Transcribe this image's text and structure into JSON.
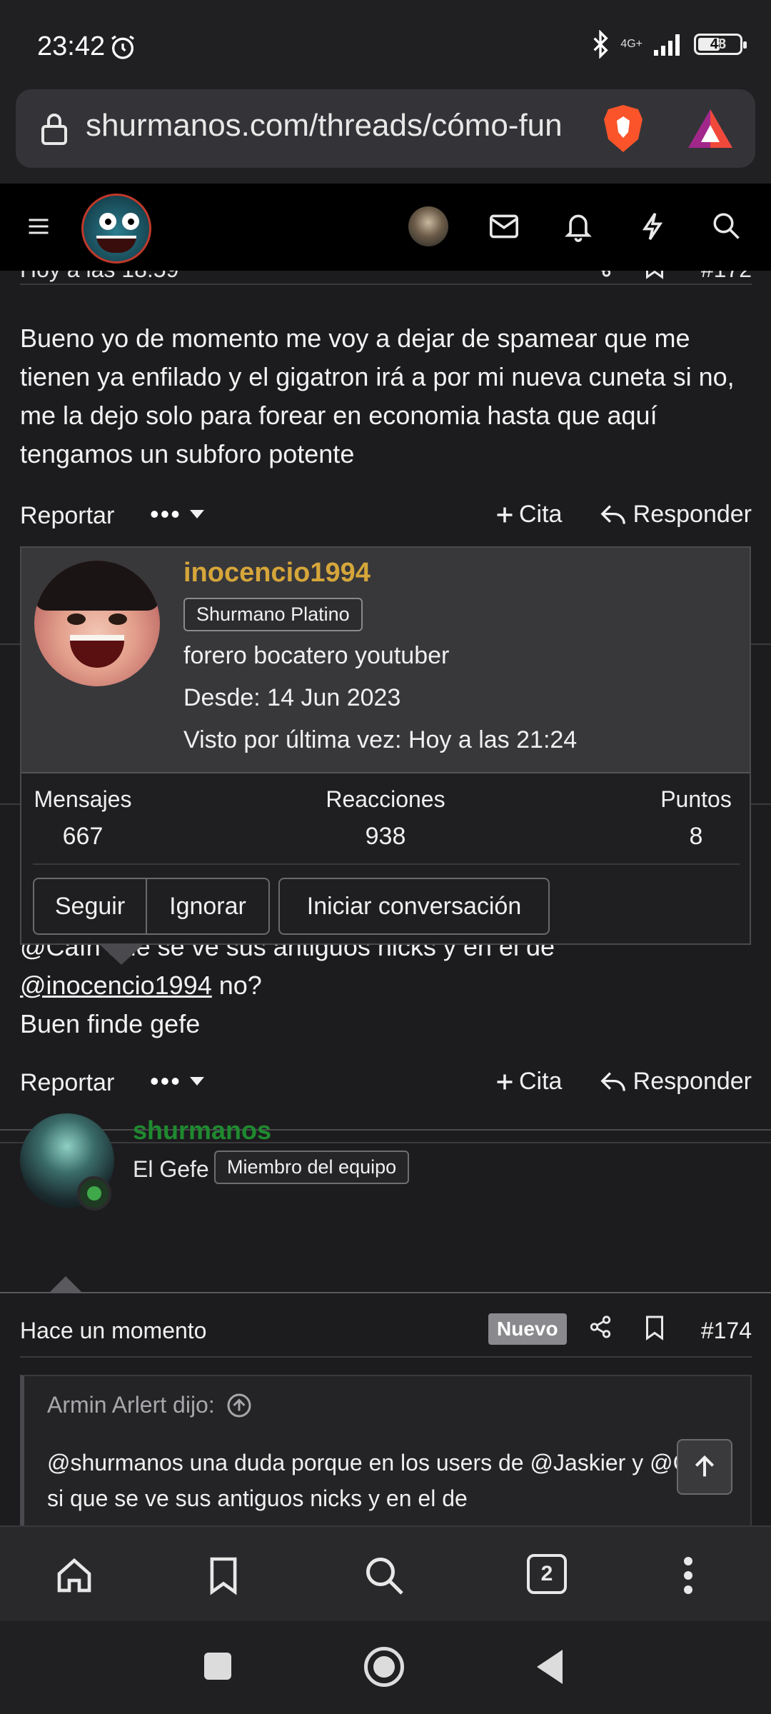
{
  "status_bar": {
    "time": "23:42",
    "network": "4G+",
    "battery": "48"
  },
  "browser": {
    "url": "shurmanos.com/threads/cómo-fun",
    "open_tabs": "2"
  },
  "previous_post": {
    "date": "Hoy a las 18:59",
    "post_number": "#172",
    "body": "Bueno yo de momento me voy a dejar de spamear que me tienen ya enfilado y el gigatron irá a por mi nueva cuneta si no, me la dejo solo para forear en economia hasta que aquí tengamos un subforo potente",
    "actions": {
      "report": "Reportar",
      "more": "•••",
      "quote": "Cita",
      "reply": "Responder"
    }
  },
  "current_post": {
    "line1_prefix": "@Caín",
    "line1_suffix": "que se ve sus antiguos nicks y en el de",
    "mention": "@inocencio1994",
    "line2_suffix": " no?",
    "line3": "Buen finde gefe",
    "actions": {
      "report": "Reportar",
      "more": "•••",
      "quote": "Cita",
      "reply": "Responder"
    }
  },
  "member_card": {
    "username": "inocencio1994",
    "rank": "Shurmano Platino",
    "bio": "forero bocatero youtuber",
    "since": "Desde: 14 Jun 2023",
    "last_seen": "Visto por última vez: Hoy a las 21:24",
    "stats": [
      {
        "label": "Mensajes",
        "value": "667"
      },
      {
        "label": "Reacciones",
        "value": "938"
      },
      {
        "label": "Puntos",
        "value": "8"
      }
    ],
    "buttons": {
      "follow": "Seguir",
      "ignore": "Ignorar",
      "start_conversation": "Iniciar conversación"
    }
  },
  "reply_post": {
    "author": "shurmanos",
    "author_title": "El Gefe",
    "author_badge": "Miembro del equipo",
    "time": "Hace un momento",
    "new_label": "Nuevo",
    "post_number": "#174",
    "quote_author": "Armin Arlert dijo:",
    "quote_text": "@shurmanos una duda porque en los users de @Jaskier y @Caín si que se ve sus antiguos nicks y en el de"
  },
  "colors": {
    "accent_gold": "#d6a63a",
    "online_green": "#1f8a2f",
    "background": "#1c1c1e"
  }
}
